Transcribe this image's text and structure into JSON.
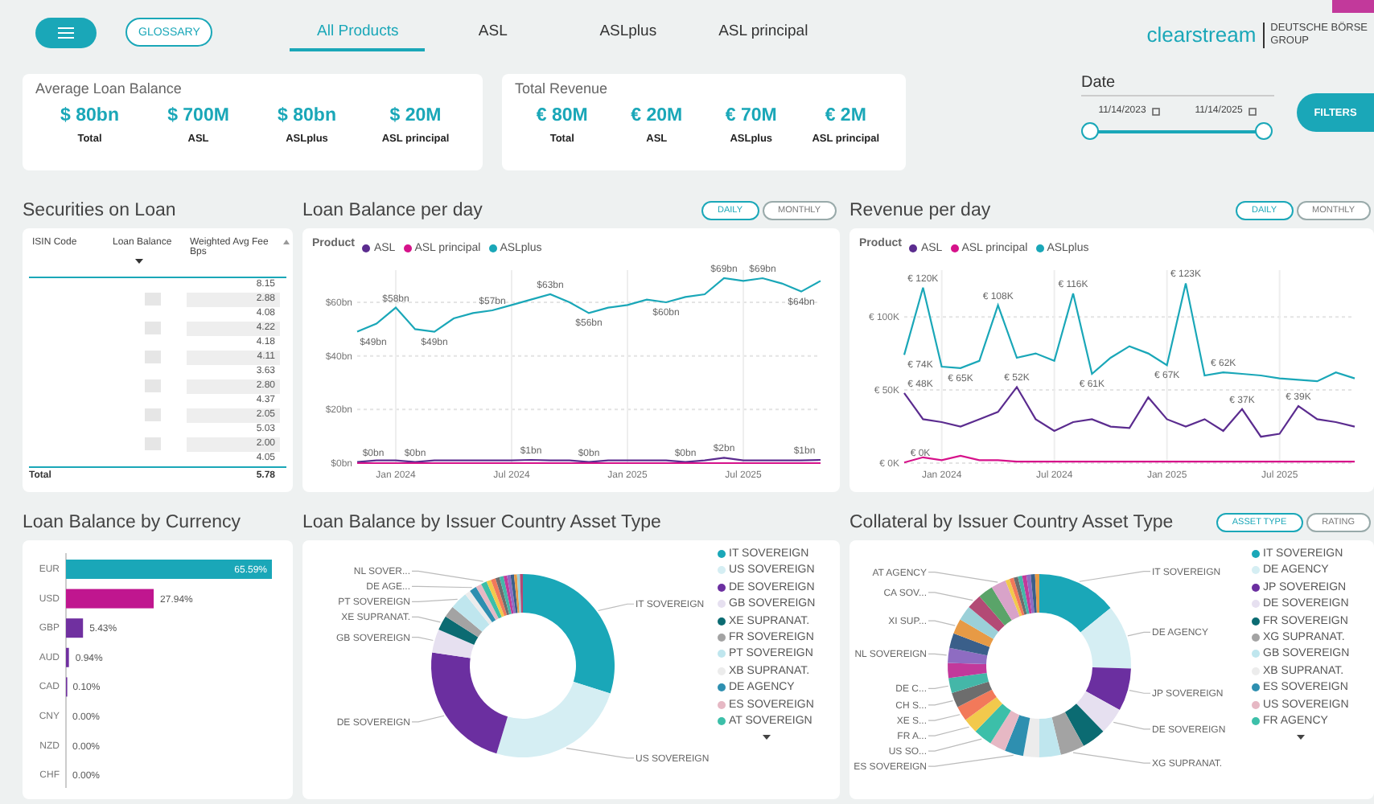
{
  "topbar": {
    "glossary_button": "GLOSSARY",
    "tabs": [
      {
        "label": "All Products",
        "selected": true
      },
      {
        "label": "ASL",
        "selected": false
      },
      {
        "label": "ASLplus",
        "selected": false
      },
      {
        "label": "ASL principal",
        "selected": false
      }
    ],
    "logo": {
      "brand": "clearstream",
      "group": "DEUTSCHE BÖRSE\nGROUP"
    }
  },
  "kpis": [
    {
      "title": "Average Loan Balance",
      "items": [
        {
          "value": "$ 80bn",
          "label": "Total"
        },
        {
          "value": "$ 700M",
          "label": "ASL"
        },
        {
          "value": "$ 80bn",
          "label": "ASLplus"
        },
        {
          "value": "$ 20M",
          "label": "ASL principal"
        }
      ]
    },
    {
      "title": "Total Revenue",
      "items": [
        {
          "value": "€ 80M",
          "label": "Total"
        },
        {
          "value": "€ 20M",
          "label": "ASL"
        },
        {
          "value": "€ 70M",
          "label": "ASLplus"
        },
        {
          "value": "€ 2M",
          "label": "ASL principal"
        }
      ]
    }
  ],
  "date_filter": {
    "label": "Date",
    "start": "11/14/2023",
    "end": "11/14/2025",
    "thumbs": [
      {
        "level": 0
      },
      {
        "level": 1
      }
    ],
    "button": "FILTERS"
  },
  "securities_on_loan": {
    "title": "Securities on Loan",
    "columns": [
      "ISIN Code",
      "Loan Balance",
      "Weighted Avg Fee Bps"
    ],
    "rows": [
      {
        "fee": "8.15"
      },
      {
        "fee": "2.88"
      },
      {
        "fee": "4.08"
      },
      {
        "fee": "4.22"
      },
      {
        "fee": "4.18"
      },
      {
        "fee": "4.11"
      },
      {
        "fee": "3.63"
      },
      {
        "fee": "2.80"
      },
      {
        "fee": "4.37"
      },
      {
        "fee": "2.05"
      },
      {
        "fee": "5.03"
      },
      {
        "fee": "2.00"
      },
      {
        "fee": "4.05"
      }
    ],
    "total": {
      "label": "Total",
      "fee": "5.78"
    }
  },
  "loan_balance_per_day": {
    "title": "Loan Balance per day",
    "toggles": [
      {
        "label": "DAILY",
        "selected": true
      },
      {
        "label": "MONTHLY",
        "selected": false
      }
    ],
    "legend_title": "Product",
    "chart_data": {
      "type": "line",
      "legend": "top-left",
      "grid": true,
      "categories": [
        null,
        null,
        "Jan 2024",
        null,
        null,
        null,
        null,
        null,
        "Jul 2024",
        null,
        null,
        null,
        null,
        null,
        "Jan 2025",
        null,
        null,
        null,
        null,
        null,
        "Jul 2025",
        null,
        null,
        null,
        null
      ],
      "ylim": [
        0,
        72
      ],
      "yticks": [
        {
          "value": 0,
          "label": "$0bn"
        },
        {
          "value": 20,
          "label": "$20bn"
        },
        {
          "value": 40,
          "label": "$40bn"
        },
        {
          "value": 60,
          "label": "$60bn"
        }
      ],
      "series": [
        {
          "name": "ASL",
          "color": "#5b2c8f",
          "values": [
            0.4,
            1,
            1,
            0.4,
            1,
            1,
            1,
            1,
            1,
            1.2,
            1,
            1,
            0.4,
            1,
            1,
            1,
            1,
            0.4,
            1,
            2,
            1,
            1,
            1,
            1,
            1.2
          ],
          "value_labels": [
            "$0bn",
            null,
            null,
            "$0bn",
            null,
            null,
            null,
            null,
            null,
            "$1bn",
            null,
            null,
            "$0bn",
            null,
            null,
            null,
            null,
            "$0bn",
            null,
            "$2bn",
            null,
            null,
            null,
            null,
            "$1bn"
          ]
        },
        {
          "name": "ASL principal",
          "color": "#d6128a",
          "values": [
            0,
            0,
            0,
            0,
            0,
            0,
            0,
            0,
            0,
            0,
            0,
            0,
            0,
            0,
            0,
            0,
            0,
            0,
            0,
            0,
            0,
            0,
            0,
            0,
            0
          ]
        },
        {
          "name": "ASLplus",
          "color": "#1aa7b8",
          "values": [
            49,
            52,
            58,
            50,
            49,
            54,
            56,
            57,
            59,
            61,
            63,
            60,
            56,
            58,
            59,
            61,
            60,
            62,
            63,
            69,
            68,
            69,
            67,
            64,
            68
          ],
          "value_labels": [
            "$49bn",
            null,
            "$58bn",
            null,
            "$49bn",
            null,
            null,
            "$57bn",
            null,
            null,
            "$63bn",
            null,
            "$56bn",
            null,
            null,
            null,
            "$60bn",
            null,
            null,
            "$69bn",
            null,
            "$69bn",
            null,
            "$64bn",
            null
          ]
        }
      ]
    }
  },
  "revenue_per_day": {
    "title": "Revenue per day",
    "toggles": [
      {
        "label": "DAILY",
        "selected": true
      },
      {
        "label": "MONTHLY",
        "selected": false
      }
    ],
    "legend_title": "Product",
    "chart_data": {
      "type": "line",
      "legend": "top-left",
      "grid": true,
      "categories": [
        null,
        null,
        "Jan 2024",
        null,
        null,
        null,
        null,
        null,
        "Jul 2024",
        null,
        null,
        null,
        null,
        null,
        "Jan 2025",
        null,
        null,
        null,
        null,
        null,
        "Jul 2025",
        null,
        null,
        null,
        null
      ],
      "ylim": [
        0,
        132
      ],
      "yticks": [
        {
          "value": 0,
          "label": "€ 0K"
        },
        {
          "value": 50,
          "label": "€ 50K"
        },
        {
          "value": 100,
          "label": "€ 100K"
        }
      ],
      "series": [
        {
          "name": "ASL",
          "color": "#5b2c8f",
          "values": [
            48,
            30,
            28,
            25,
            30,
            35,
            52,
            30,
            22,
            28,
            30,
            25,
            24,
            45,
            30,
            25,
            30,
            22,
            37,
            18,
            20,
            39,
            30,
            28,
            25
          ],
          "value_labels": [
            "€ 48K",
            null,
            null,
            null,
            null,
            null,
            "€ 52K",
            null,
            null,
            null,
            null,
            null,
            null,
            null,
            null,
            null,
            null,
            null,
            "€ 37K",
            null,
            null,
            "€ 39K",
            null,
            null,
            null
          ]
        },
        {
          "name": "ASL principal",
          "color": "#d6128a",
          "values": [
            0.4,
            4,
            2,
            5,
            2,
            2,
            1,
            1,
            1,
            1,
            1,
            1,
            1,
            1,
            1,
            1,
            1,
            1,
            1,
            1,
            1,
            1,
            1,
            1,
            1
          ],
          "value_labels": [
            "€ 0K",
            null,
            null,
            null,
            null,
            null,
            null,
            null,
            null,
            null,
            null,
            null,
            null,
            null,
            null,
            null,
            null,
            null,
            null,
            null,
            null,
            null,
            null,
            null,
            null
          ]
        },
        {
          "name": "ASLplus",
          "color": "#1aa7b8",
          "values": [
            74,
            120,
            66,
            65,
            70,
            108,
            72,
            75,
            70,
            116,
            61,
            72,
            80,
            75,
            67,
            123,
            60,
            62,
            61,
            60,
            58,
            57,
            56,
            62,
            58
          ],
          "value_labels": [
            "€ 74K",
            "€ 120K",
            null,
            "€ 65K",
            null,
            "€ 108K",
            null,
            null,
            null,
            "€ 116K",
            "€ 61K",
            null,
            null,
            null,
            "€ 67K",
            "€ 123K",
            null,
            "€ 62K",
            null,
            null,
            null,
            null,
            null,
            null,
            null
          ]
        }
      ]
    }
  },
  "loan_balance_by_currency": {
    "title": "Loan Balance by Currency",
    "chart_data": {
      "type": "bar",
      "orientation": "horizontal",
      "categories": [
        "EUR",
        "USD",
        "GBP",
        "AUD",
        "CAD",
        "CNY",
        "NZD",
        "CHF"
      ],
      "series": [
        {
          "color": "#1aa7b8",
          "values": [
            65.59,
            null,
            null,
            null,
            null,
            null,
            null,
            null
          ],
          "value_labels": [
            "65.59%",
            null,
            null,
            null,
            null,
            null,
            null,
            null
          ]
        },
        {
          "color": "#c0168f",
          "values": [
            null,
            27.94,
            null,
            null,
            null,
            null,
            null,
            null
          ],
          "value_labels": [
            null,
            "27.94%",
            null,
            null,
            null,
            null,
            null,
            null
          ]
        },
        {
          "color": "#7030a0",
          "values": [
            null,
            null,
            5.43,
            0.94,
            0.1,
            0.0,
            0.0,
            0.0
          ],
          "value_labels": [
            null,
            null,
            "5.43%",
            "0.94%",
            "0.10%",
            "0.00%",
            "0.00%",
            "0.00%"
          ]
        }
      ]
    }
  },
  "loan_balance_by_issuer": {
    "title": "Loan Balance by Issuer Country Asset Type",
    "labels": [
      "NL SOVER...",
      "DE AGE...",
      "PT SOVEREIGN",
      "IT SOVEREIGN",
      "XE SUPRANAT.",
      "GB SOVEREIGN",
      "DE SOVEREIGN",
      "US SOVEREIGN"
    ],
    "legend": [
      {
        "label": "IT SOVEREIGN",
        "color": "#1aa7b8"
      },
      {
        "label": "US SOVEREIGN",
        "color": "#d5eef3"
      },
      {
        "label": "DE SOVEREIGN",
        "color": "#6b2fa0"
      },
      {
        "label": "GB SOVEREIGN",
        "color": "#e6e0f0"
      },
      {
        "label": "XE SUPRANAT.",
        "color": "#0b6b72"
      },
      {
        "label": "FR SOVEREIGN",
        "color": "#a3a3a3"
      },
      {
        "label": "PT SOVEREIGN",
        "color": "#bfe6ee"
      },
      {
        "label": "XB SUPRANAT.",
        "color": "#ececec"
      },
      {
        "label": "DE AGENCY",
        "color": "#2e8fb0"
      },
      {
        "label": "ES SOVEREIGN",
        "color": "#e6b8c4"
      },
      {
        "label": "AT SOVEREIGN",
        "color": "#3cbfa9"
      }
    ]
  },
  "collateral_by_issuer": {
    "title": "Collateral by Issuer Country Asset Type",
    "toggles": [
      {
        "label": "ASSET TYPE",
        "selected": true
      },
      {
        "label": "RATING",
        "selected": false
      }
    ],
    "labels": [
      "AT AGENCY",
      "IT SOVEREIGN",
      "CA SOV...",
      "XI SUP...",
      "DE AGENCY",
      "NL SOVEREIGN",
      "DE C...",
      "JP SOVEREIGN",
      "CH S...",
      "XE S...",
      "DE SOVEREIGN",
      "FR A...",
      "US SO...",
      "XG SUPRANAT.",
      "ES SOVEREIGN"
    ],
    "legend": [
      {
        "label": "IT SOVEREIGN",
        "color": "#1aa7b8"
      },
      {
        "label": "DE AGENCY",
        "color": "#d5eef3"
      },
      {
        "label": "JP SOVEREIGN",
        "color": "#6b2fa0"
      },
      {
        "label": "DE SOVEREIGN",
        "color": "#e6e0f0"
      },
      {
        "label": "FR SOVEREIGN",
        "color": "#0b6b72"
      },
      {
        "label": "XG SUPRANAT.",
        "color": "#a3a3a3"
      },
      {
        "label": "GB SOVEREIGN",
        "color": "#bfe6ee"
      },
      {
        "label": "XB SUPRANAT.",
        "color": "#ececec"
      },
      {
        "label": "ES SOVEREIGN",
        "color": "#2e8fb0"
      },
      {
        "label": "US SOVEREIGN",
        "color": "#e6b8c4"
      },
      {
        "label": "FR AGENCY",
        "color": "#3cbfa9"
      }
    ]
  }
}
